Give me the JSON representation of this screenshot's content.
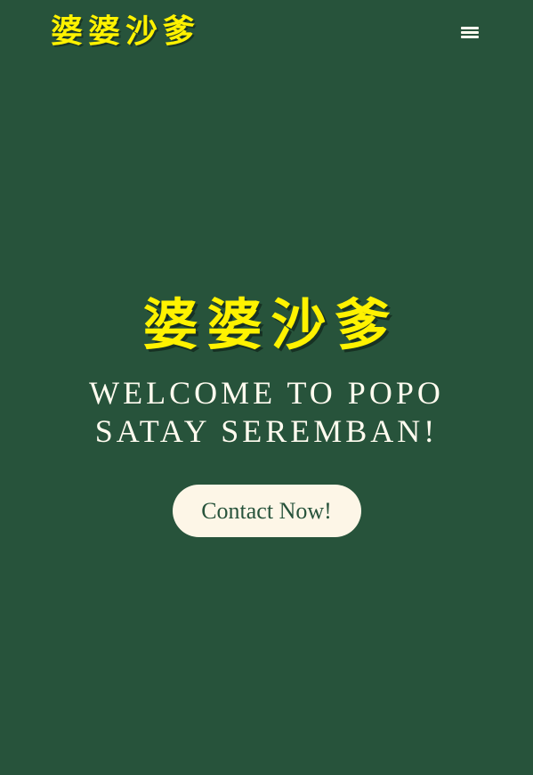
{
  "colors": {
    "background": "#27533b",
    "brand_yellow": "#fff200",
    "text_light": "#fffbef",
    "button_bg": "#fdf6e7",
    "button_text": "#27533b"
  },
  "header": {
    "logo_text": "婆婆沙爹",
    "menu_icon": "hamburger-menu-icon"
  },
  "hero": {
    "title": "婆婆沙爹",
    "subtitle": "Welcome to Popo Satay Seremban!",
    "cta_label": "Contact Now!"
  }
}
